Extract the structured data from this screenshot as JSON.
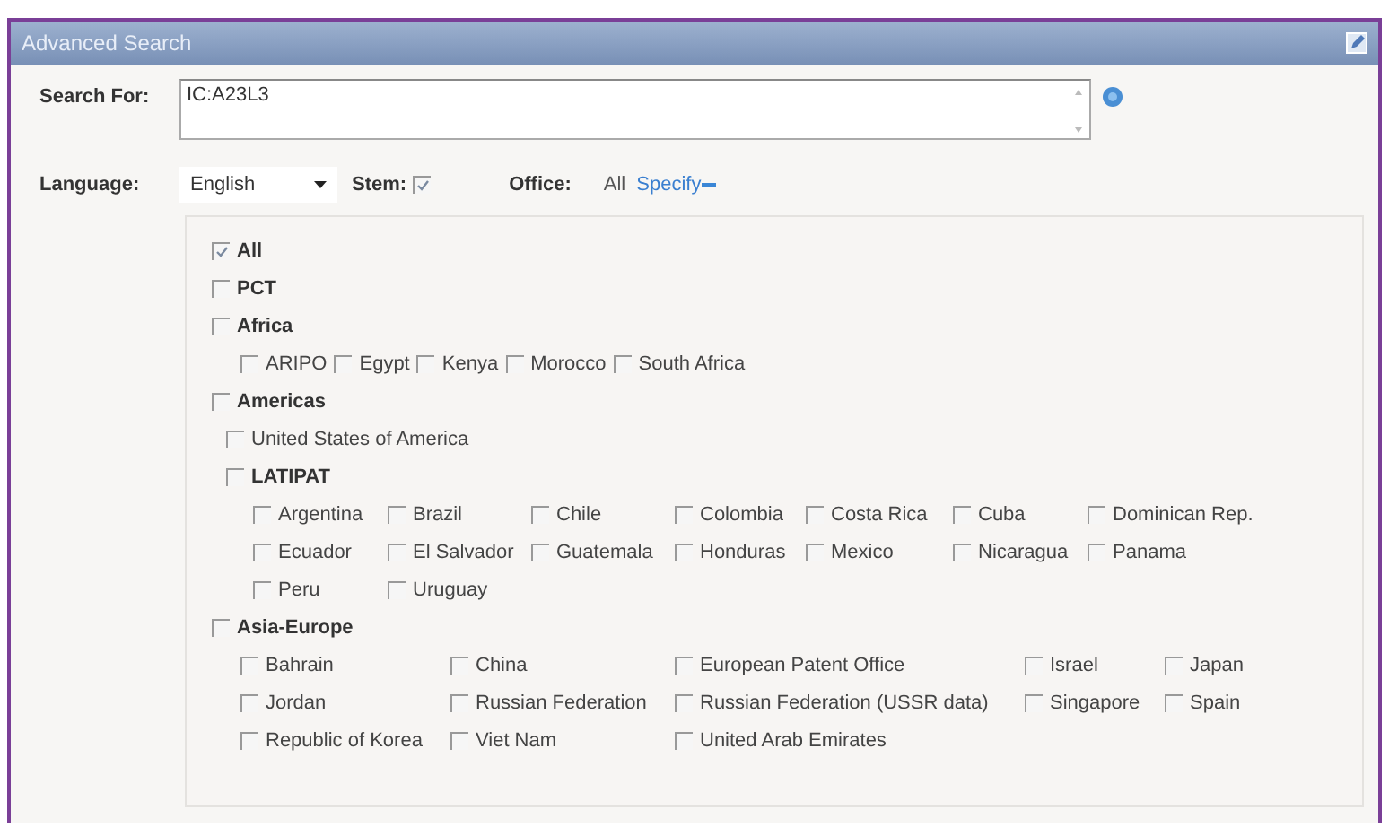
{
  "window": {
    "title": "Advanced Search"
  },
  "search": {
    "label": "Search For:",
    "value": "IC:A23L3"
  },
  "language": {
    "label": "Language:",
    "value": "English"
  },
  "stem": {
    "label": "Stem:",
    "checked": true
  },
  "office": {
    "label": "Office:",
    "value": "All",
    "link": "Specify",
    "expanded": true
  },
  "offices": [
    {
      "kind": "heading",
      "label": "All",
      "checked": true
    },
    {
      "kind": "heading",
      "label": "PCT",
      "checked": false
    },
    {
      "kind": "inline",
      "label": "Africa",
      "checked": false,
      "children": [
        {
          "kind": "option",
          "label": "ARIPO",
          "checked": false
        },
        {
          "kind": "option",
          "label": "Egypt",
          "checked": false
        },
        {
          "kind": "option",
          "label": "Kenya",
          "checked": false
        },
        {
          "kind": "option",
          "label": "Morocco",
          "checked": false
        },
        {
          "kind": "option",
          "label": "South Africa",
          "checked": false
        }
      ]
    },
    {
      "kind": "stack",
      "label": "Americas",
      "checked": false,
      "children": [
        {
          "kind": "option",
          "label": "United States of America",
          "checked": false
        },
        {
          "kind": "grid",
          "label": "LATIPAT",
          "checked": false,
          "children": [
            {
              "kind": "option",
              "label": "Argentina",
              "checked": false
            },
            {
              "kind": "option",
              "label": "Brazil",
              "checked": false
            },
            {
              "kind": "option",
              "label": "Chile",
              "checked": false
            },
            {
              "kind": "option",
              "label": "Colombia",
              "checked": false
            },
            {
              "kind": "option",
              "label": "Costa Rica",
              "checked": false
            },
            {
              "kind": "option",
              "label": "Cuba",
              "checked": false
            },
            {
              "kind": "option",
              "label": "Dominican Rep.",
              "checked": false
            },
            {
              "kind": "option",
              "label": "Ecuador",
              "checked": false
            },
            {
              "kind": "option",
              "label": "El Salvador",
              "checked": false
            },
            {
              "kind": "option",
              "label": "Guatemala",
              "checked": false
            },
            {
              "kind": "option",
              "label": "Honduras",
              "checked": false
            },
            {
              "kind": "option",
              "label": "Mexico",
              "checked": false
            },
            {
              "kind": "option",
              "label": "Nicaragua",
              "checked": false
            },
            {
              "kind": "option",
              "label": "Panama",
              "checked": false
            },
            {
              "kind": "option",
              "label": "Peru",
              "checked": false
            },
            {
              "kind": "option",
              "label": "Uruguay",
              "checked": false
            }
          ]
        }
      ]
    },
    {
      "kind": "grid",
      "label": "Asia-Europe",
      "checked": false,
      "children": [
        {
          "kind": "option",
          "label": "Bahrain",
          "checked": false
        },
        {
          "kind": "option",
          "label": "China",
          "checked": false
        },
        {
          "kind": "option",
          "label": "European Patent Office",
          "checked": false
        },
        {
          "kind": "option",
          "label": "Israel",
          "checked": false
        },
        {
          "kind": "option",
          "label": "Japan",
          "checked": false
        },
        {
          "kind": "option",
          "label": "Jordan",
          "checked": false
        },
        {
          "kind": "option",
          "label": "Russian Federation",
          "checked": false
        },
        {
          "kind": "option",
          "label": "Russian Federation (USSR data)",
          "checked": false
        },
        {
          "kind": "option",
          "label": "Singapore",
          "checked": false
        },
        {
          "kind": "option",
          "label": "Spain",
          "checked": false
        },
        {
          "kind": "option",
          "label": "Republic of Korea",
          "checked": false
        },
        {
          "kind": "option",
          "label": "Viet Nam",
          "checked": false
        },
        {
          "kind": "option",
          "label": "United Arab Emirates",
          "checked": false
        }
      ]
    }
  ]
}
